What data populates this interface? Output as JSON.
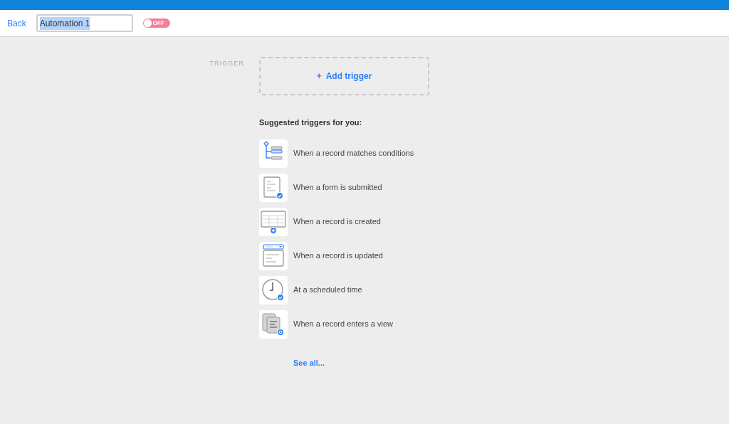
{
  "header": {
    "back": "Back",
    "name_field": {
      "value": "Automation 1",
      "selected_text": true
    },
    "toggle": {
      "on": false,
      "label": "OFF"
    }
  },
  "trigger": {
    "label": "TRIGGER",
    "add_button": {
      "icon": "+",
      "label": "Add trigger"
    }
  },
  "suggestions": {
    "heading": "Suggested triggers for you:",
    "items": [
      {
        "kind": "conditions",
        "label": "When a record matches conditions"
      },
      {
        "kind": "form",
        "label": "When a form is submitted"
      },
      {
        "kind": "created",
        "label": "When a record is created"
      },
      {
        "kind": "updated",
        "label": "When a record is updated"
      },
      {
        "kind": "scheduled",
        "label": "At a scheduled time"
      },
      {
        "kind": "view",
        "label": "When a record enters a view"
      }
    ],
    "see_all": "See all..."
  }
}
